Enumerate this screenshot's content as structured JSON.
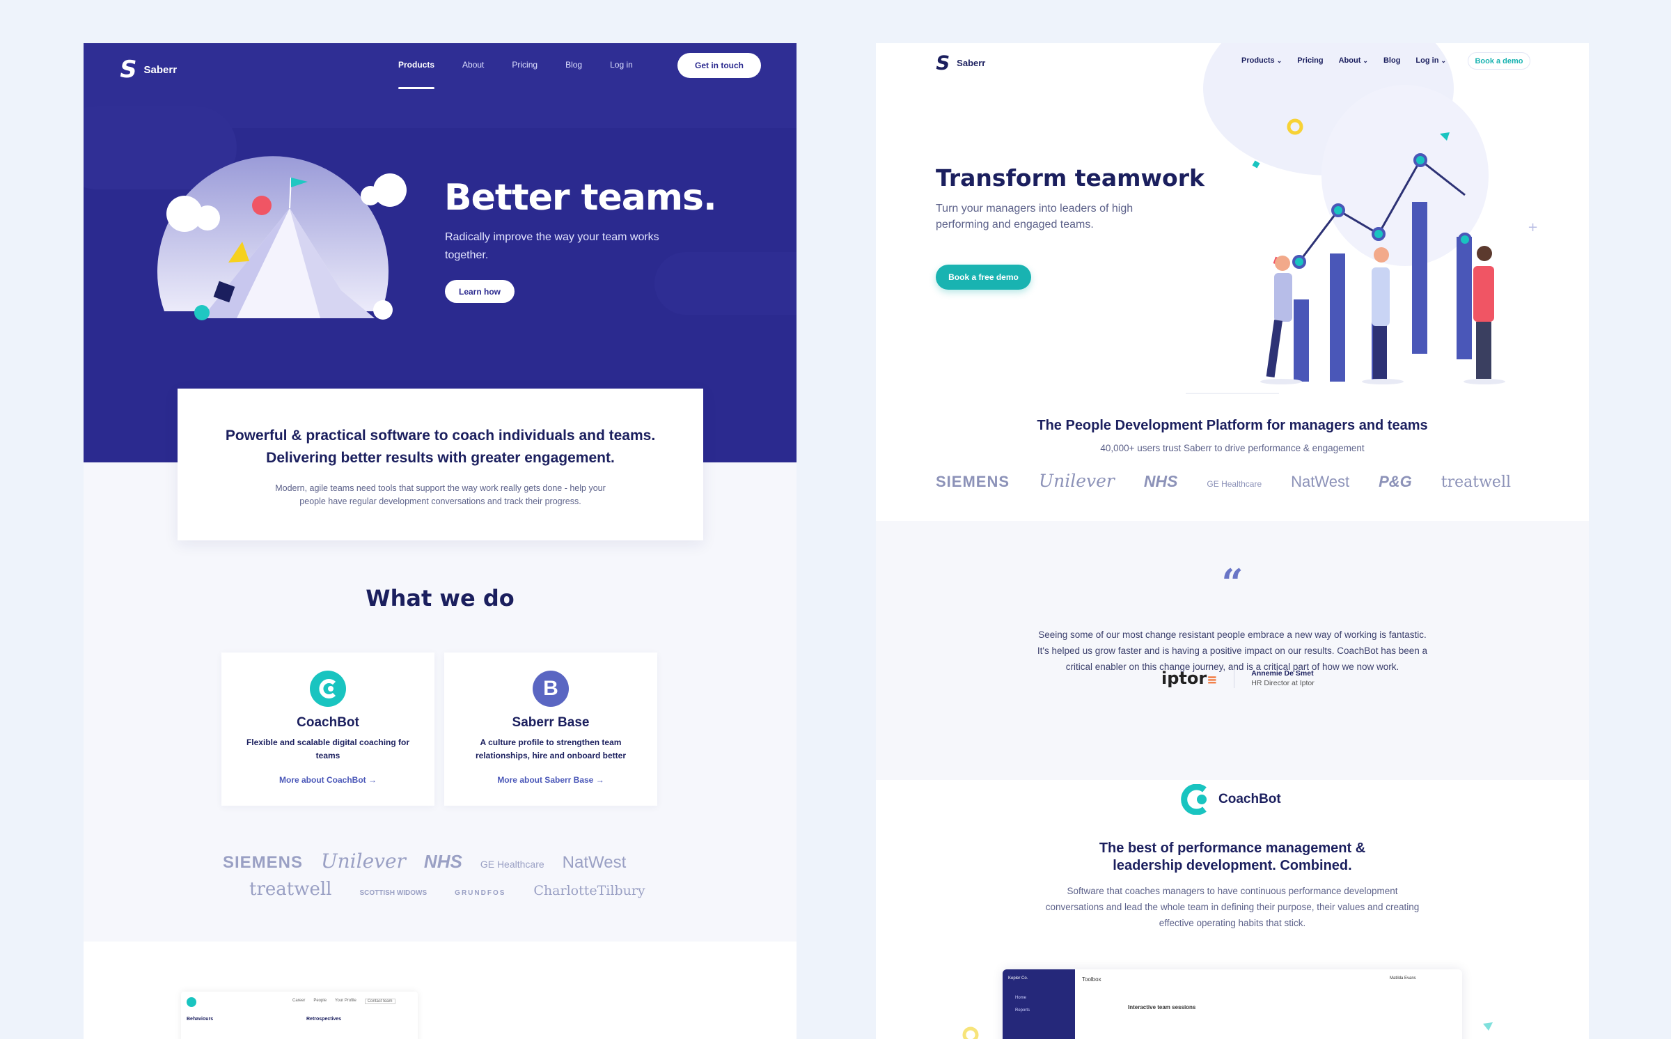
{
  "left": {
    "nav": {
      "brand": "Saberr",
      "links": [
        "Products",
        "About",
        "Pricing",
        "Blog",
        "Log in"
      ],
      "cta": "Get in touch"
    },
    "hero": {
      "title": "Better teams.",
      "subtitle": "Radically improve the way your team works together.",
      "cta": "Learn how"
    },
    "intro": {
      "heading": "Powerful & practical software to coach individuals and teams. Delivering better results with greater engagement.",
      "body": "Modern, agile teams need tools that support the way work really gets done - help your people have regular development conversations and track their progress."
    },
    "what_we_do": "What we do",
    "products": [
      {
        "name": "CoachBot",
        "desc": "Flexible and scalable digital coaching for teams",
        "link": "More about CoachBot →",
        "color": "#19c4c0"
      },
      {
        "name": "Saberr Base",
        "desc": "A culture profile to strengthen team relationships, hire and onboard better",
        "link": "More about Saberr Base →",
        "color": "#5a66c2"
      }
    ],
    "brands_row1": [
      "SIEMENS",
      "Unilever",
      "NHS",
      "GE Healthcare",
      "NatWest"
    ],
    "brands_row2": [
      "treatwell",
      "SCOTTISH WIDOWS",
      "GRUNDFOS",
      "CharlotteTilbury"
    ],
    "mini_app": {
      "tabs": [
        "Career",
        "People",
        "Your Profile"
      ],
      "button": "Contact team",
      "col1": "Behaviours",
      "col2": "Retrospectives"
    }
  },
  "right": {
    "nav": {
      "brand": "Saberr",
      "links": [
        "Products",
        "Pricing",
        "About",
        "Blog",
        "Log in"
      ],
      "cta": "Book a demo"
    },
    "hero": {
      "title": "Transform teamwork",
      "subtitle": "Turn your managers into leaders of high performing and engaged teams.",
      "cta": "Book a free demo"
    },
    "platform": {
      "heading": "The People Development Platform for managers and teams",
      "sub": "40,000+ users trust Saberr to drive performance & engagement"
    },
    "brands": [
      "SIEMENS",
      "Unilever",
      "NHS",
      "GE Healthcare",
      "NatWest",
      "P&G",
      "treatwell"
    ],
    "testimonial": {
      "mark": "“",
      "quote": "Seeing some of our most change resistant people embrace a new way of working is fantastic. It's helped us grow faster and is having a positive impact on our results. CoachBot has been a critical enabler on this change journey, and is a critical part of how we now work.",
      "company": "iptor",
      "name": "Annemie De Smet",
      "role": "HR Director at Iptor"
    },
    "coachbot": {
      "name": "CoachBot",
      "title": "The best of performance management & leadership development. Combined.",
      "body": "Software that coaches managers to have continuous performance development conversations and lead the whole team in defining their purpose, their values and creating effective operating habits that stick."
    },
    "app": {
      "org": "Kepler Co.",
      "section": "Toolbox",
      "menu": [
        "Home",
        "Reports"
      ],
      "item": "Interactive team sessions",
      "user": "Matilda Evans"
    }
  }
}
